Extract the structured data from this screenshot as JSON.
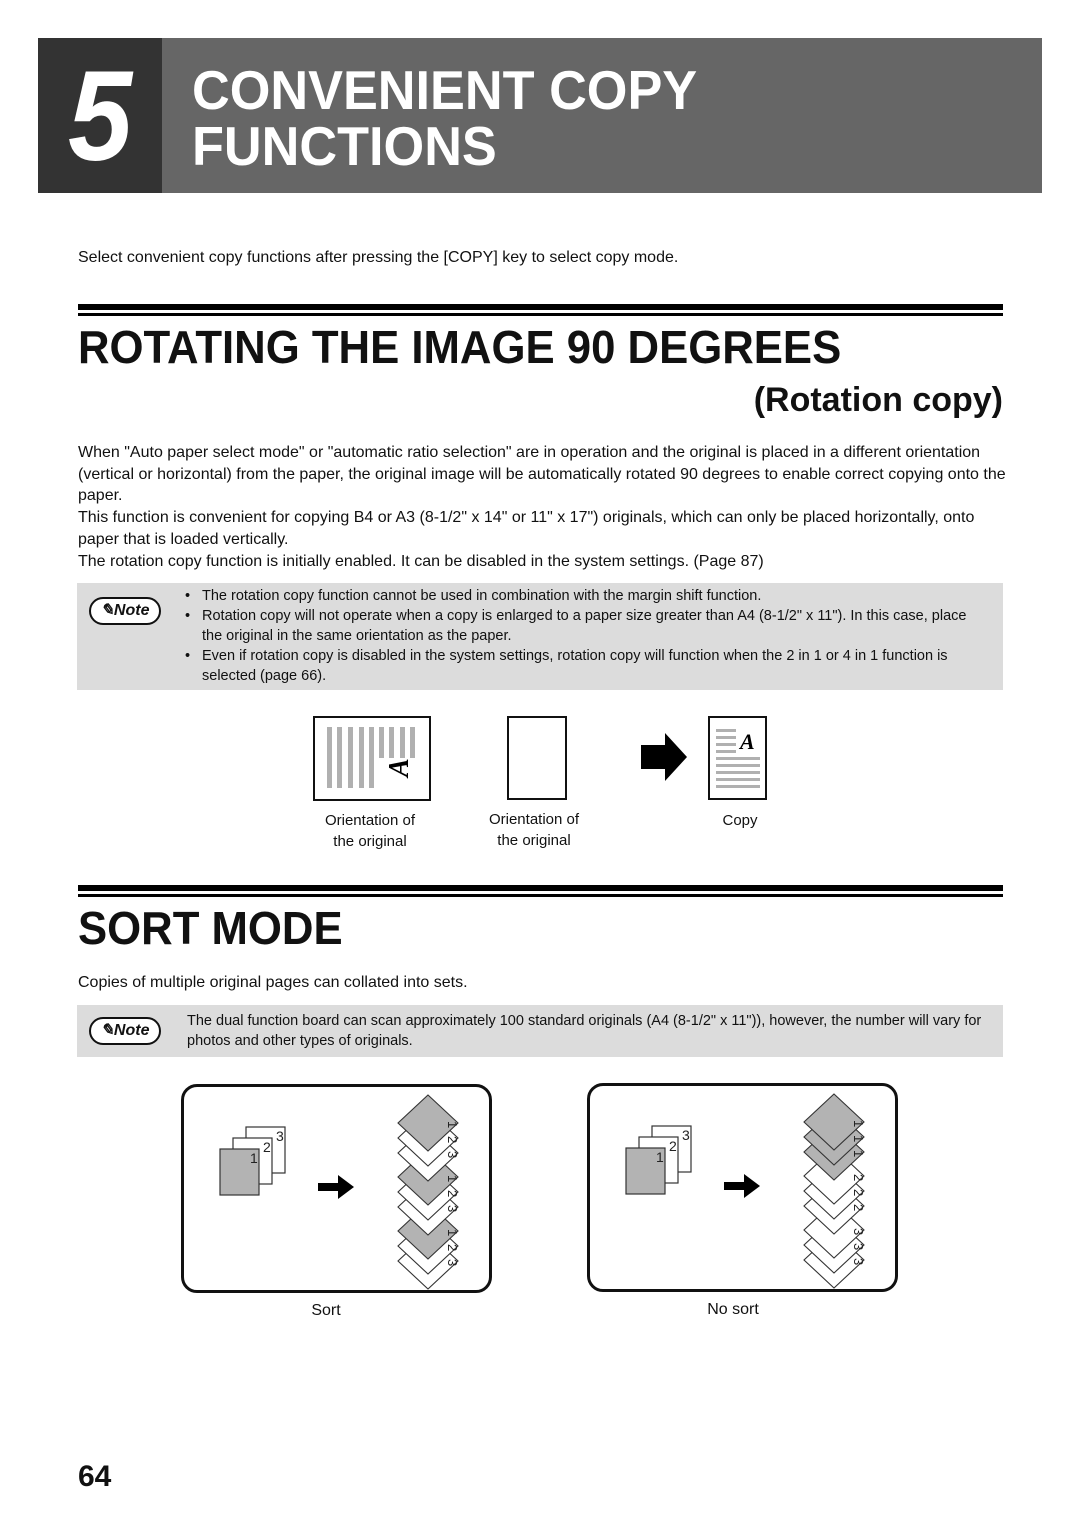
{
  "chapter": {
    "number": "5",
    "title_line1": "CONVENIENT COPY",
    "title_line2": "FUNCTIONS"
  },
  "intro": "Select convenient copy functions after pressing the [COPY] key to select copy mode.",
  "rotation": {
    "heading": "ROTATING THE IMAGE 90 DEGREES",
    "subheading": "(Rotation copy)",
    "paragraphs": [
      "When \"Auto paper select mode\" or \"automatic ratio selection\" are in operation and the original is placed in a different orientation (vertical or horizontal) from the paper, the original image will be automatically rotated 90 degrees to enable correct copying onto the paper.",
      "This function is convenient for copying B4 or A3 (8-1/2\" x 14\" or 11\" x 17\") originals, which can only be placed horizontally, onto paper that is loaded vertically.",
      "The rotation copy function is initially enabled. It can be disabled in the system settings. (Page 87)"
    ],
    "note": {
      "badge": "Note",
      "items": [
        "The rotation copy function cannot be used in combination with the margin shift function.",
        "Rotation copy will not operate when a copy is enlarged to a paper size greater than A4 (8-1/2\" x 11\"). In this case, place the original in the same orientation as the paper.",
        "Even if rotation copy is disabled in the system settings, rotation copy will function when the 2 in 1 or 4 in 1 function is selected (page 66)."
      ]
    },
    "figure": {
      "caption1_line1": "Orientation of",
      "caption1_line2": "the original",
      "caption2_line1": "Orientation of",
      "caption2_line2": "the original",
      "caption3": "Copy",
      "glyph": "A"
    }
  },
  "sort": {
    "heading": "SORT MODE",
    "intro": "Copies of multiple original pages can collated into sets.",
    "note": {
      "badge": "Note",
      "text": "The dual function board can scan approximately 100 standard originals (A4 (8-1/2\" x 11\")), however, the number will vary for photos and other types of originals."
    },
    "figure": {
      "originals": [
        "1",
        "2",
        "3"
      ],
      "sort_output": [
        "1",
        "2",
        "3",
        "1",
        "2",
        "3",
        "1",
        "2",
        "3"
      ],
      "nosort_output": [
        "1",
        "1",
        "1",
        "2",
        "2",
        "2",
        "3",
        "3",
        "3"
      ],
      "sort_label": "Sort",
      "nosort_label": "No sort"
    }
  },
  "colors": {
    "chapter_bar": "#666666",
    "chapter_num_box": "#333333",
    "note_bg": "#dcdcdc",
    "shaded_page": "#b3b3b3",
    "line_gray": "#b0b0b0"
  },
  "page_number": "64"
}
